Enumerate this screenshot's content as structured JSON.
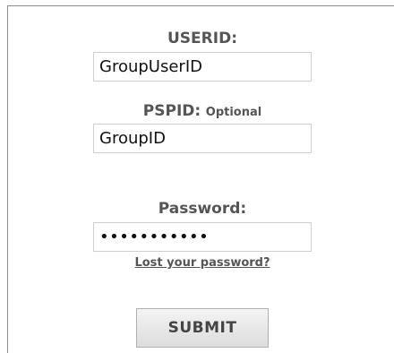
{
  "login": {
    "userid_label": "USERID:",
    "userid_value": "GroupUserID",
    "pspid_label": "PSPID:",
    "pspid_optional": "Optional",
    "pspid_value": "GroupID",
    "password_label": "Password:",
    "password_value": "•••••••••••",
    "lost_password": "Lost your password?",
    "submit_label": "SUBMIT"
  }
}
